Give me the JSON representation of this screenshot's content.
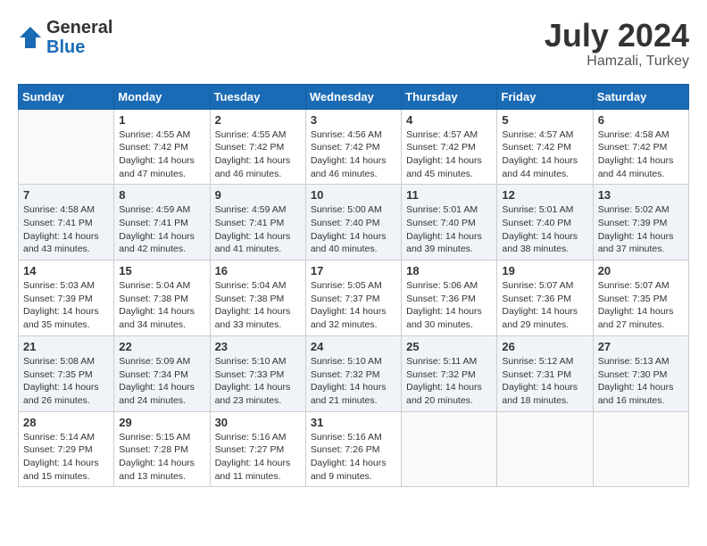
{
  "header": {
    "logo": {
      "general": "General",
      "blue": "Blue"
    },
    "title": "July 2024",
    "location": "Hamzali, Turkey"
  },
  "days_of_week": [
    "Sunday",
    "Monday",
    "Tuesday",
    "Wednesday",
    "Thursday",
    "Friday",
    "Saturday"
  ],
  "weeks": [
    [
      {
        "day": "",
        "info": ""
      },
      {
        "day": "1",
        "info": "Sunrise: 4:55 AM\nSunset: 7:42 PM\nDaylight: 14 hours\nand 47 minutes."
      },
      {
        "day": "2",
        "info": "Sunrise: 4:55 AM\nSunset: 7:42 PM\nDaylight: 14 hours\nand 46 minutes."
      },
      {
        "day": "3",
        "info": "Sunrise: 4:56 AM\nSunset: 7:42 PM\nDaylight: 14 hours\nand 46 minutes."
      },
      {
        "day": "4",
        "info": "Sunrise: 4:57 AM\nSunset: 7:42 PM\nDaylight: 14 hours\nand 45 minutes."
      },
      {
        "day": "5",
        "info": "Sunrise: 4:57 AM\nSunset: 7:42 PM\nDaylight: 14 hours\nand 44 minutes."
      },
      {
        "day": "6",
        "info": "Sunrise: 4:58 AM\nSunset: 7:42 PM\nDaylight: 14 hours\nand 44 minutes."
      }
    ],
    [
      {
        "day": "7",
        "info": "Sunrise: 4:58 AM\nSunset: 7:41 PM\nDaylight: 14 hours\nand 43 minutes."
      },
      {
        "day": "8",
        "info": "Sunrise: 4:59 AM\nSunset: 7:41 PM\nDaylight: 14 hours\nand 42 minutes."
      },
      {
        "day": "9",
        "info": "Sunrise: 4:59 AM\nSunset: 7:41 PM\nDaylight: 14 hours\nand 41 minutes."
      },
      {
        "day": "10",
        "info": "Sunrise: 5:00 AM\nSunset: 7:40 PM\nDaylight: 14 hours\nand 40 minutes."
      },
      {
        "day": "11",
        "info": "Sunrise: 5:01 AM\nSunset: 7:40 PM\nDaylight: 14 hours\nand 39 minutes."
      },
      {
        "day": "12",
        "info": "Sunrise: 5:01 AM\nSunset: 7:40 PM\nDaylight: 14 hours\nand 38 minutes."
      },
      {
        "day": "13",
        "info": "Sunrise: 5:02 AM\nSunset: 7:39 PM\nDaylight: 14 hours\nand 37 minutes."
      }
    ],
    [
      {
        "day": "14",
        "info": "Sunrise: 5:03 AM\nSunset: 7:39 PM\nDaylight: 14 hours\nand 35 minutes."
      },
      {
        "day": "15",
        "info": "Sunrise: 5:04 AM\nSunset: 7:38 PM\nDaylight: 14 hours\nand 34 minutes."
      },
      {
        "day": "16",
        "info": "Sunrise: 5:04 AM\nSunset: 7:38 PM\nDaylight: 14 hours\nand 33 minutes."
      },
      {
        "day": "17",
        "info": "Sunrise: 5:05 AM\nSunset: 7:37 PM\nDaylight: 14 hours\nand 32 minutes."
      },
      {
        "day": "18",
        "info": "Sunrise: 5:06 AM\nSunset: 7:36 PM\nDaylight: 14 hours\nand 30 minutes."
      },
      {
        "day": "19",
        "info": "Sunrise: 5:07 AM\nSunset: 7:36 PM\nDaylight: 14 hours\nand 29 minutes."
      },
      {
        "day": "20",
        "info": "Sunrise: 5:07 AM\nSunset: 7:35 PM\nDaylight: 14 hours\nand 27 minutes."
      }
    ],
    [
      {
        "day": "21",
        "info": "Sunrise: 5:08 AM\nSunset: 7:35 PM\nDaylight: 14 hours\nand 26 minutes."
      },
      {
        "day": "22",
        "info": "Sunrise: 5:09 AM\nSunset: 7:34 PM\nDaylight: 14 hours\nand 24 minutes."
      },
      {
        "day": "23",
        "info": "Sunrise: 5:10 AM\nSunset: 7:33 PM\nDaylight: 14 hours\nand 23 minutes."
      },
      {
        "day": "24",
        "info": "Sunrise: 5:10 AM\nSunset: 7:32 PM\nDaylight: 14 hours\nand 21 minutes."
      },
      {
        "day": "25",
        "info": "Sunrise: 5:11 AM\nSunset: 7:32 PM\nDaylight: 14 hours\nand 20 minutes."
      },
      {
        "day": "26",
        "info": "Sunrise: 5:12 AM\nSunset: 7:31 PM\nDaylight: 14 hours\nand 18 minutes."
      },
      {
        "day": "27",
        "info": "Sunrise: 5:13 AM\nSunset: 7:30 PM\nDaylight: 14 hours\nand 16 minutes."
      }
    ],
    [
      {
        "day": "28",
        "info": "Sunrise: 5:14 AM\nSunset: 7:29 PM\nDaylight: 14 hours\nand 15 minutes."
      },
      {
        "day": "29",
        "info": "Sunrise: 5:15 AM\nSunset: 7:28 PM\nDaylight: 14 hours\nand 13 minutes."
      },
      {
        "day": "30",
        "info": "Sunrise: 5:16 AM\nSunset: 7:27 PM\nDaylight: 14 hours\nand 11 minutes."
      },
      {
        "day": "31",
        "info": "Sunrise: 5:16 AM\nSunset: 7:26 PM\nDaylight: 14 hours\nand 9 minutes."
      },
      {
        "day": "",
        "info": ""
      },
      {
        "day": "",
        "info": ""
      },
      {
        "day": "",
        "info": ""
      }
    ]
  ]
}
